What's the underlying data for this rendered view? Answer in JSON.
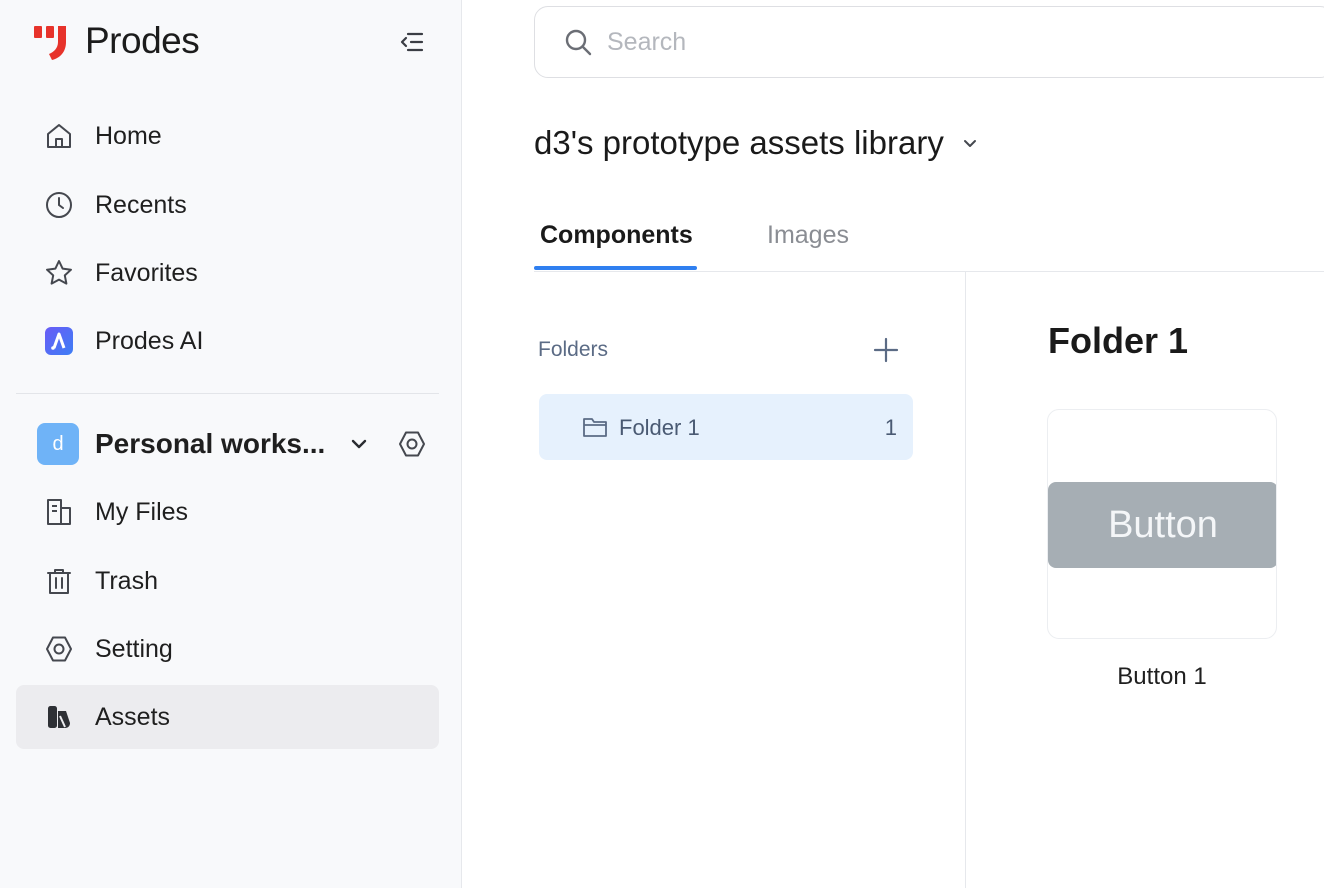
{
  "brand": {
    "name": "Prodes",
    "accent": "#e7332b"
  },
  "sidebar": {
    "collapse_icon": "collapse-sidebar-icon",
    "nav": [
      {
        "label": "Home",
        "icon": "home-icon"
      },
      {
        "label": "Recents",
        "icon": "clock-icon"
      },
      {
        "label": "Favorites",
        "icon": "star-icon"
      },
      {
        "label": "Prodes AI",
        "icon": "prodes-ai-icon"
      }
    ],
    "workspace": {
      "avatar_letter": "d",
      "name": "Personal works...",
      "items": [
        {
          "label": "My Files",
          "icon": "file-icon"
        },
        {
          "label": "Trash",
          "icon": "trash-icon"
        },
        {
          "label": "Setting",
          "icon": "gear-icon"
        },
        {
          "label": "Assets",
          "icon": "assets-icon",
          "active": true
        }
      ]
    }
  },
  "search": {
    "placeholder": "Search"
  },
  "library": {
    "title": "d3's prototype assets library",
    "tabs": [
      {
        "label": "Components",
        "active": true
      },
      {
        "label": "Images",
        "active": false
      }
    ]
  },
  "folders": {
    "heading": "Folders",
    "items": [
      {
        "name": "Folder 1",
        "count": "1"
      }
    ]
  },
  "content": {
    "title": "Folder 1",
    "cards": [
      {
        "preview_text": "Button",
        "name": "Button 1"
      }
    ]
  }
}
